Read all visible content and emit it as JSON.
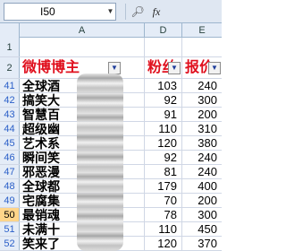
{
  "formula_bar": {
    "cell_ref": "I50",
    "zoom_icon": "magnifier-icon",
    "fx_label": "fx"
  },
  "columns": [
    {
      "label": "A"
    },
    {
      "label": "D"
    },
    {
      "label": "E"
    }
  ],
  "rows": [
    {
      "num": "1",
      "name": "",
      "fans": "",
      "price": ""
    },
    {
      "num": "2",
      "name": "微博博主",
      "fans": "粉丝",
      "price": "报价"
    },
    {
      "num": "41",
      "name": "全球酒",
      "fans": "103",
      "price": "240"
    },
    {
      "num": "42",
      "name": "搞笑大",
      "fans": "92",
      "price": "300"
    },
    {
      "num": "43",
      "name": "智慧百",
      "fans": "91",
      "price": "200"
    },
    {
      "num": "44",
      "name": "超级幽",
      "fans": "110",
      "price": "310"
    },
    {
      "num": "45",
      "name": "艺术系",
      "fans": "120",
      "price": "380"
    },
    {
      "num": "46",
      "name": "瞬间笑",
      "fans": "92",
      "price": "240"
    },
    {
      "num": "47",
      "name": "邪恶漫",
      "fans": "81",
      "price": "240"
    },
    {
      "num": "48",
      "name": "全球都",
      "fans": "179",
      "price": "400"
    },
    {
      "num": "49",
      "name": "宅腐集",
      "fans": "70",
      "price": "200"
    },
    {
      "num": "50",
      "name": "最销魂",
      "fans": "78",
      "price": "300"
    },
    {
      "num": "51",
      "name": "未满十",
      "fans": "110",
      "price": "450"
    },
    {
      "num": "52",
      "name": "笑来了",
      "fans": "120",
      "price": "370"
    }
  ],
  "colors": {
    "header_text": "#e0101e",
    "filtered_row_number": "#2b5fc8",
    "selected_row_header": "#ffd58a"
  }
}
